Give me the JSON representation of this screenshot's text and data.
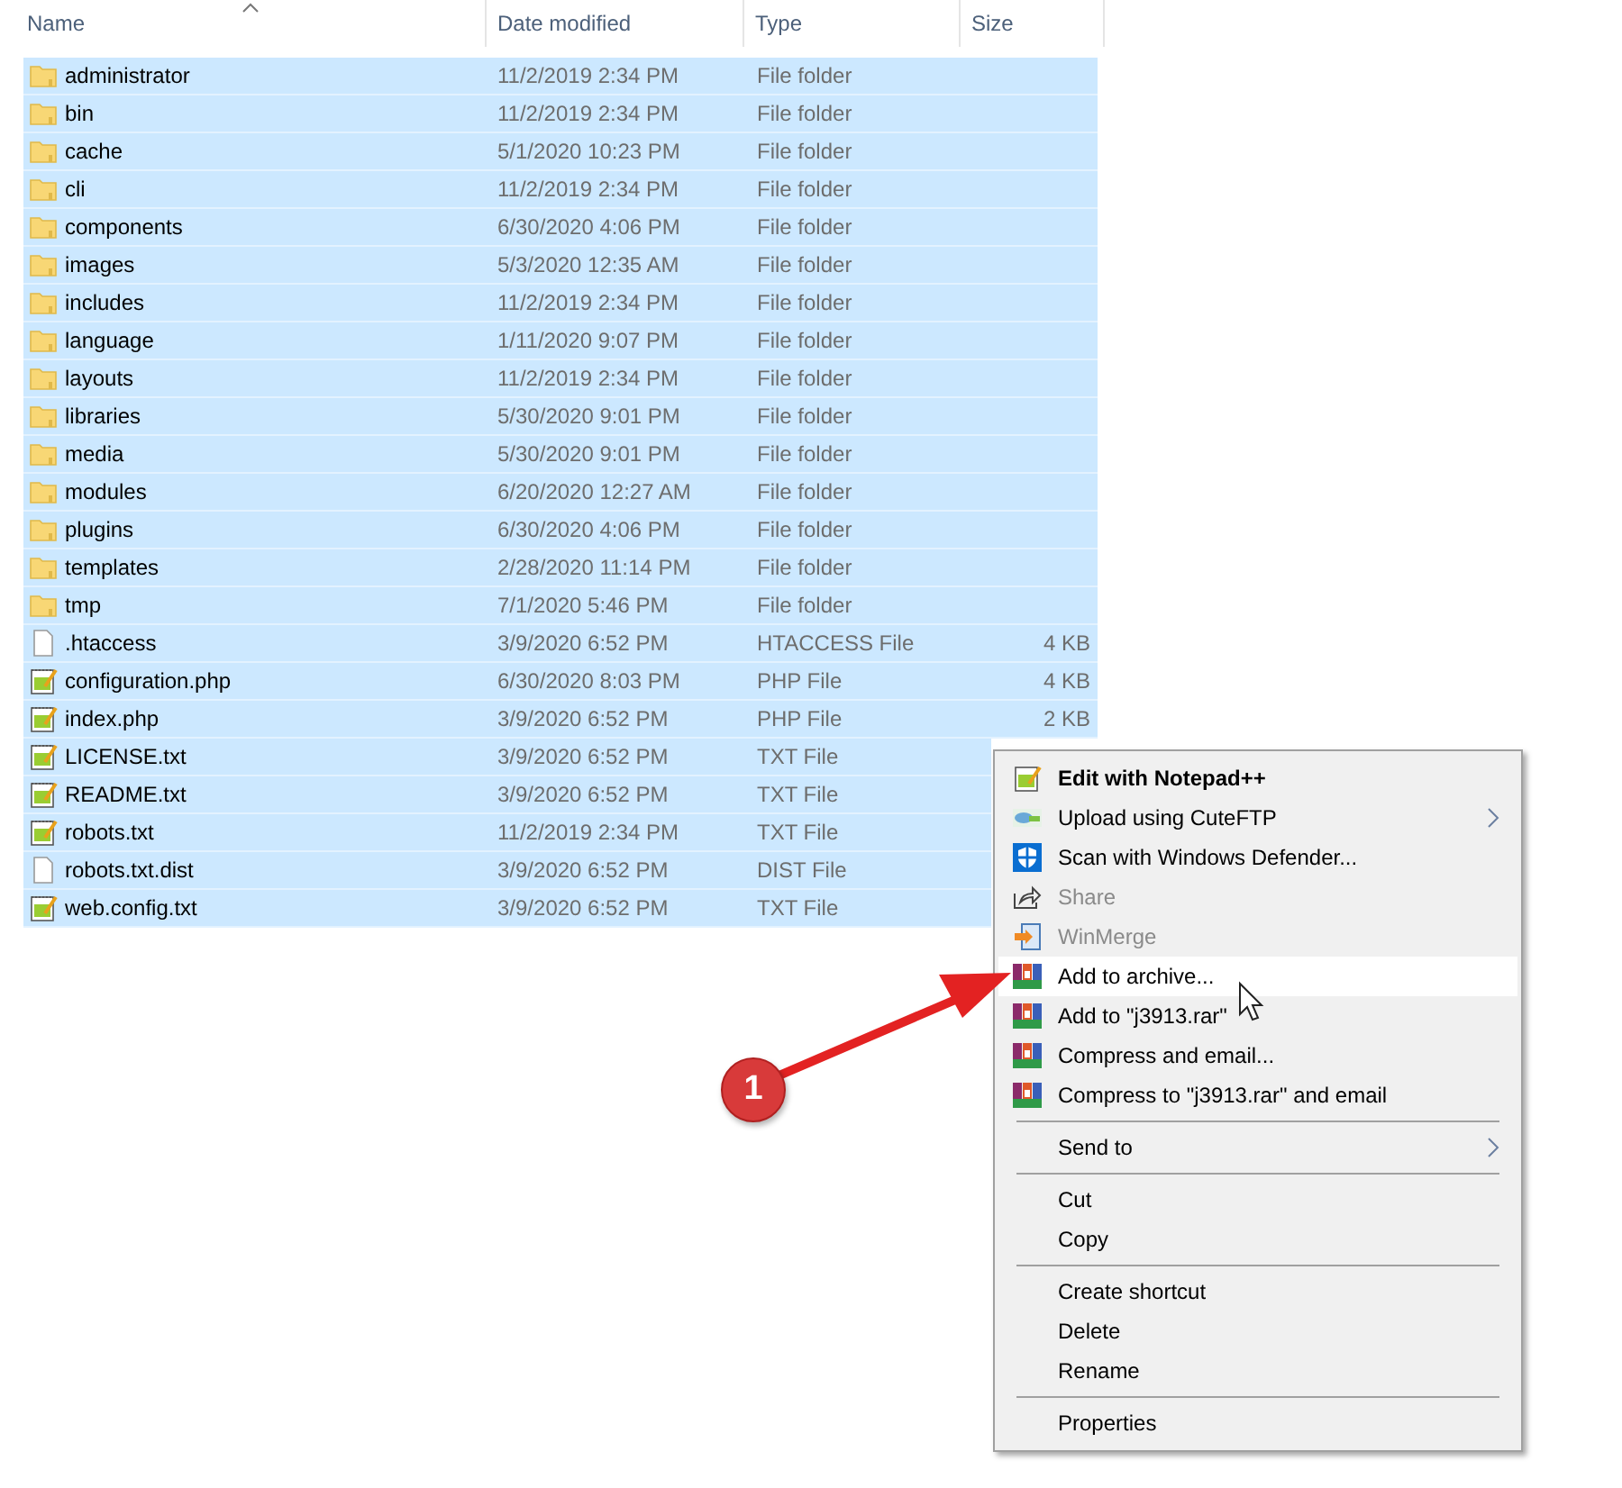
{
  "table": {
    "columns": [
      "Name",
      "Date modified",
      "Type",
      "Size"
    ],
    "rows": [
      {
        "kind": "folder",
        "name": "administrator",
        "date": "11/2/2019 2:34 PM",
        "type": "File folder",
        "selected": true
      },
      {
        "kind": "folder",
        "name": "bin",
        "date": "11/2/2019 2:34 PM",
        "type": "File folder",
        "selected": true
      },
      {
        "kind": "folder",
        "name": "cache",
        "date": "5/1/2020 10:23 PM",
        "type": "File folder",
        "selected": true
      },
      {
        "kind": "folder",
        "name": "cli",
        "date": "11/2/2019 2:34 PM",
        "type": "File folder",
        "selected": true
      },
      {
        "kind": "folder",
        "name": "components",
        "date": "6/30/2020 4:06 PM",
        "type": "File folder",
        "selected": true
      },
      {
        "kind": "folder",
        "name": "images",
        "date": "5/3/2020 12:35 AM",
        "type": "File folder",
        "selected": true
      },
      {
        "kind": "folder",
        "name": "includes",
        "date": "11/2/2019 2:34 PM",
        "type": "File folder",
        "selected": true
      },
      {
        "kind": "folder",
        "name": "language",
        "date": "1/11/2020 9:07 PM",
        "type": "File folder",
        "selected": true
      },
      {
        "kind": "folder",
        "name": "layouts",
        "date": "11/2/2019 2:34 PM",
        "type": "File folder",
        "selected": true
      },
      {
        "kind": "folder",
        "name": "libraries",
        "date": "5/30/2020 9:01 PM",
        "type": "File folder",
        "selected": true
      },
      {
        "kind": "folder",
        "name": "media",
        "date": "5/30/2020 9:01 PM",
        "type": "File folder",
        "selected": true
      },
      {
        "kind": "folder",
        "name": "modules",
        "date": "6/20/2020 12:27 AM",
        "type": "File folder",
        "selected": true
      },
      {
        "kind": "folder",
        "name": "plugins",
        "date": "6/30/2020 4:06 PM",
        "type": "File folder",
        "selected": true
      },
      {
        "kind": "folder",
        "name": "templates",
        "date": "2/28/2020 11:14 PM",
        "type": "File folder",
        "selected": true
      },
      {
        "kind": "folder",
        "name": "tmp",
        "date": "7/1/2020 5:46 PM",
        "type": "File folder",
        "selected": true
      },
      {
        "kind": "blank",
        "name": ".htaccess",
        "date": "3/9/2020 6:52 PM",
        "type": "HTACCESS File",
        "size": "4 KB",
        "selected": true
      },
      {
        "kind": "notepad",
        "name": "configuration.php",
        "date": "6/30/2020 8:03 PM",
        "type": "PHP File",
        "size": "4 KB",
        "selected": true
      },
      {
        "kind": "notepad",
        "name": "index.php",
        "date": "3/9/2020 6:52 PM",
        "type": "PHP File",
        "size": "2 KB",
        "selected": true
      },
      {
        "kind": "notepad",
        "name": "LICENSE.txt",
        "date": "3/9/2020 6:52 PM",
        "type": "TXT File",
        "selected": true
      },
      {
        "kind": "notepad",
        "name": "README.txt",
        "date": "3/9/2020 6:52 PM",
        "type": "TXT File",
        "selected": true
      },
      {
        "kind": "notepad",
        "name": "robots.txt",
        "date": "11/2/2019 2:34 PM",
        "type": "TXT File",
        "selected": true
      },
      {
        "kind": "blank",
        "name": "robots.txt.dist",
        "date": "3/9/2020 6:52 PM",
        "type": "DIST File",
        "selected": true
      },
      {
        "kind": "notepad",
        "name": "web.config.txt",
        "date": "3/9/2020 6:52 PM",
        "type": "TXT File",
        "selected": true
      }
    ]
  },
  "context_menu": {
    "items": [
      {
        "kind": "notepad",
        "label": "Edit with Notepad++",
        "bold": true,
        "disabled": false,
        "submenu": false,
        "selected": false
      },
      {
        "kind": "cuteftp",
        "label": "Upload using CuteFTP",
        "bold": false,
        "disabled": false,
        "submenu": true,
        "selected": false
      },
      {
        "kind": "shield",
        "label": "Scan with Windows Defender...",
        "bold": false,
        "disabled": false,
        "submenu": false,
        "selected": false
      },
      {
        "kind": "share",
        "label": "Share",
        "bold": false,
        "disabled": true,
        "submenu": false,
        "selected": false
      },
      {
        "kind": "winmerge",
        "label": "WinMerge",
        "bold": false,
        "disabled": true,
        "submenu": false,
        "selected": false
      },
      {
        "kind": "winrar",
        "label": "Add to archive...",
        "bold": false,
        "disabled": false,
        "submenu": false,
        "selected": true
      },
      {
        "kind": "winrar",
        "label": "Add to \"j3913.rar\"",
        "bold": false,
        "disabled": false,
        "submenu": false,
        "selected": false
      },
      {
        "kind": "winrar",
        "label": "Compress and email...",
        "bold": false,
        "disabled": false,
        "submenu": false,
        "selected": false
      },
      {
        "kind": "winrar",
        "label": "Compress to \"j3913.rar\" and email",
        "bold": false,
        "disabled": false,
        "submenu": false,
        "selected": false
      },
      {
        "kind": "separator"
      },
      {
        "kind": "item",
        "label": "Send to",
        "bold": false,
        "disabled": false,
        "submenu": true,
        "selected": false
      },
      {
        "kind": "separator"
      },
      {
        "kind": "item",
        "label": "Cut",
        "bold": false,
        "disabled": false,
        "submenu": false,
        "selected": false
      },
      {
        "kind": "item",
        "label": "Copy",
        "bold": false,
        "disabled": false,
        "submenu": false,
        "selected": false
      },
      {
        "kind": "separator"
      },
      {
        "kind": "item",
        "label": "Create shortcut",
        "bold": false,
        "disabled": false,
        "submenu": false,
        "selected": false
      },
      {
        "kind": "item",
        "label": "Delete",
        "bold": false,
        "disabled": false,
        "submenu": false,
        "selected": false
      },
      {
        "kind": "item",
        "label": "Rename",
        "bold": false,
        "disabled": false,
        "submenu": false,
        "selected": false
      },
      {
        "kind": "separator"
      },
      {
        "kind": "item",
        "label": "Properties",
        "bold": false,
        "disabled": false,
        "submenu": false,
        "selected": false
      }
    ]
  },
  "annotation": {
    "badge": "1"
  }
}
